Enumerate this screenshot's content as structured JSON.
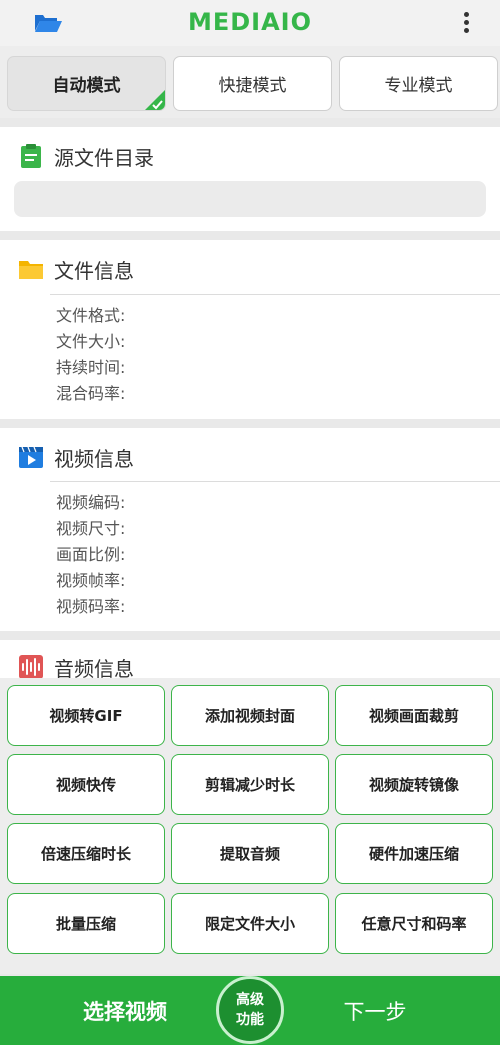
{
  "app": {
    "logo": "MEDIAIO"
  },
  "colors": {
    "brand": "#35b649",
    "bottom_bar": "#27ad3c",
    "button_border": "#3db44a"
  },
  "tabs": [
    {
      "label": "自动模式",
      "selected": true
    },
    {
      "label": "快捷模式",
      "selected": false
    },
    {
      "label": "专业模式",
      "selected": false
    }
  ],
  "source": {
    "title": "源文件目录",
    "icon": "clipboard-icon",
    "path_value": ""
  },
  "file_info": {
    "title": "文件信息",
    "icon": "folder-icon",
    "fields": [
      "文件格式:",
      "文件大小:",
      "持续时间:",
      "混合码率:"
    ]
  },
  "video_info": {
    "title": "视频信息",
    "icon": "video-play-icon",
    "fields": [
      "视频编码:",
      "视频尺寸:",
      "画面比例:",
      "视频帧率:",
      "视频码率:"
    ]
  },
  "audio_info": {
    "title": "音频信息",
    "icon": "audio-wave-icon"
  },
  "functions": [
    "视频转GIF",
    "添加视频封面",
    "视频画面裁剪",
    "视频快传",
    "剪辑减少时长",
    "视频旋转镜像",
    "倍速压缩时长",
    "提取音频",
    "硬件加速压缩",
    "批量压缩",
    "限定文件大小",
    "任意尺寸和码率"
  ],
  "bottom": {
    "select_label": "选择视频",
    "advanced_line1": "高级",
    "advanced_line2": "功能",
    "next_label": "下一步"
  }
}
